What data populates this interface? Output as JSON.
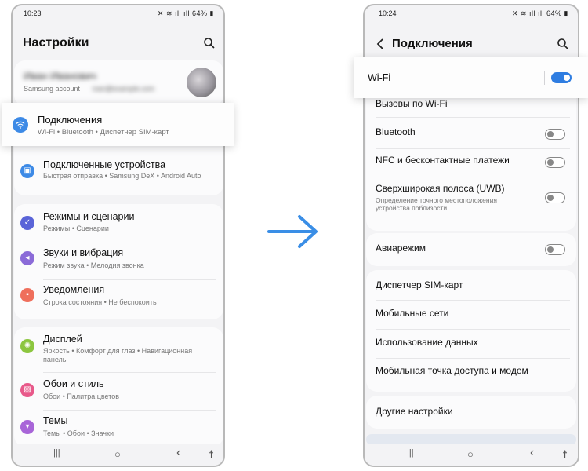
{
  "left": {
    "status": {
      "time": "10:23",
      "battery": "64%"
    },
    "title": "Настройки",
    "account": {
      "name": "Иван Иванович",
      "sub": "Samsung account",
      "email": "ivan@example.com"
    },
    "connections": {
      "title": "Подключения",
      "sub": "Wi-Fi  •  Bluetooth  •  Диспетчер SIM-карт"
    },
    "devices": {
      "title": "Подключенные устройства",
      "sub": "Быстрая отправка  •  Samsung DeX  •  Android Auto"
    },
    "modes": {
      "title": "Режимы и сценарии",
      "sub": "Режимы  •  Сценарии"
    },
    "sounds": {
      "title": "Звуки и вибрация",
      "sub": "Режим звука  •  Мелодия звонка"
    },
    "notifications": {
      "title": "Уведомления",
      "sub": "Строка состояния  •  Не беспокоить"
    },
    "display": {
      "title": "Дисплей",
      "sub": "Яркость  •  Комфорт для глаз  •  Навигационная панель"
    },
    "wallpaper": {
      "title": "Обои и стиль",
      "sub": "Обои  •  Палитра цветов"
    },
    "themes": {
      "title": "Темы",
      "sub": "Темы  •  Обои  •  Значки"
    },
    "nav": {
      "recents": "|||",
      "home": "○",
      "back": "‹",
      "accessibility": "☨"
    }
  },
  "right": {
    "status": {
      "time": "10:24",
      "battery": "64%"
    },
    "title": "Подключения",
    "wifi": {
      "label": "Wi-Fi",
      "on": true
    },
    "wifi_calls": "Вызовы по Wi-Fi",
    "bluetooth": {
      "label": "Bluetooth",
      "on": false
    },
    "nfc": {
      "label": "NFC и бесконтактные платежи",
      "on": false
    },
    "uwb": {
      "label": "Сверхширокая полоса (UWB)",
      "sub": "Определение точного местоположения устройства поблизости.",
      "on": false
    },
    "airplane": {
      "label": "Авиарежим",
      "on": false
    },
    "sim": "Диспетчер SIM-карт",
    "mobile": "Мобильные сети",
    "data_usage": "Использование данных",
    "hotspot": "Мобильная точка доступа и модем",
    "more": "Другие настройки",
    "nav": {
      "recents": "|||",
      "home": "○",
      "back": "‹",
      "accessibility": "☨"
    }
  },
  "colors": {
    "accent": "#2f7de1",
    "arrow": "#3a8ee6",
    "connections_icon": "#3d8ae6",
    "devices_icon": "#3d8ae6",
    "modes_icon": "#5a64d8",
    "sounds_icon": "#8b6bd8",
    "notifications_icon": "#ef6f5c",
    "display_icon": "#8cc63f",
    "wallpaper_icon": "#e8598a",
    "themes_icon": "#a865d8"
  }
}
